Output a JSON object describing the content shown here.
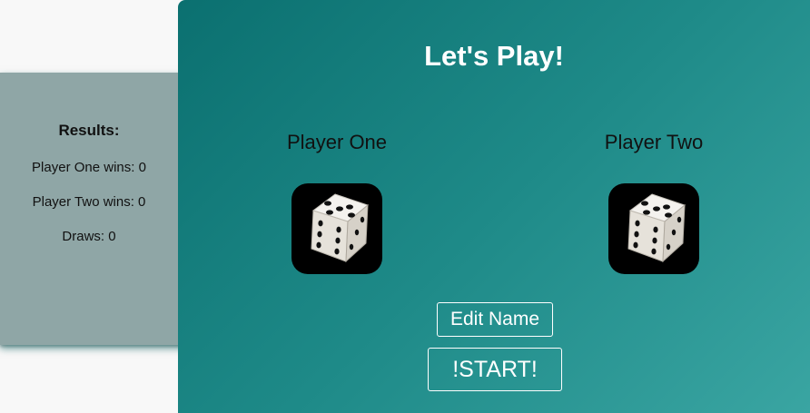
{
  "results": {
    "title": "Results:",
    "player_one_wins": "Player One wins: 0",
    "player_two_wins": "Player Two wins: 0",
    "draws": "Draws: 0"
  },
  "game": {
    "title": "Let's Play!",
    "players": [
      {
        "name": "Player One",
        "dice_icon": "dice-icon"
      },
      {
        "name": "Player Two",
        "dice_icon": "dice-icon"
      }
    ],
    "edit_name_label": "Edit Name",
    "start_label": "!START!"
  },
  "colors": {
    "panel_gradient_start": "#0b7070",
    "panel_gradient_end": "#3aa5a2",
    "sidebar_bg": "#8fa6a6",
    "button_border": "#ffffff"
  }
}
